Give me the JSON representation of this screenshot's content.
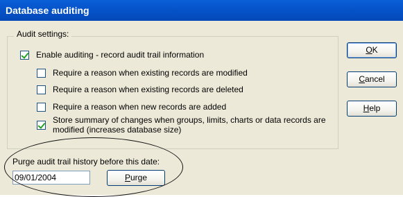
{
  "window": {
    "title": "Database auditing"
  },
  "audit_settings": {
    "legend": "Audit settings:",
    "enable_auditing": {
      "label": "Enable auditing - record audit trail information",
      "checked": true
    },
    "options": [
      {
        "label": "Require a reason when existing records are modified",
        "checked": false
      },
      {
        "label": "Require a reason when existing records are deleted",
        "checked": false
      },
      {
        "label": "Require a reason when new records are added",
        "checked": false
      },
      {
        "label_line1": "Store summary of changes when groups, limits, charts or data records are",
        "label_line2": "modified (increases database size)",
        "checked": true
      }
    ]
  },
  "buttons": {
    "ok": {
      "mnemonic": "O",
      "rest": "K"
    },
    "cancel": {
      "mnemonic": "C",
      "rest": "ancel"
    },
    "help": {
      "mnemonic": "H",
      "rest": "elp"
    }
  },
  "purge": {
    "label": "Purge audit trail history before this date:",
    "date_value": "09/01/2004",
    "button": {
      "mnemonic": "P",
      "rest": "urge"
    }
  }
}
